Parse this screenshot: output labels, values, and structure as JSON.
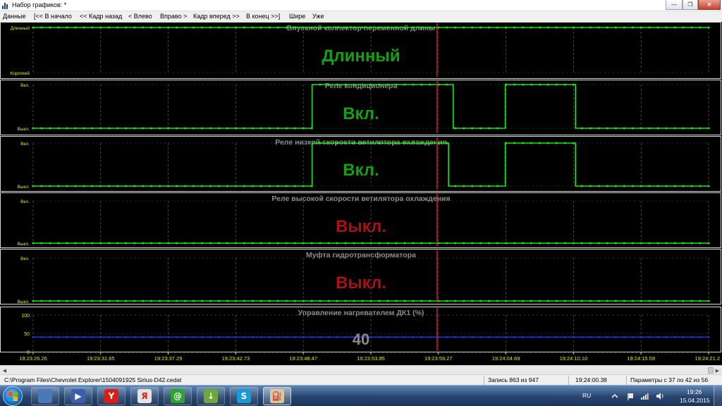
{
  "window": {
    "title": "Набор графиков: *",
    "minimize_label": "—",
    "maximize_label": "❐",
    "close_label": "✕"
  },
  "menu": [
    "Данные",
    "[<< В начало",
    "<< Кадр назад",
    "< Влево",
    "Вправо >",
    "Кадр вперед >>",
    "В конец >>]",
    "Шире",
    "Уже"
  ],
  "chart_data": [
    {
      "type": "line",
      "title": "Впускной коллектор переменной длины",
      "levels": [
        "Короткий",
        "Длинный"
      ],
      "segments": [
        [
          0,
          100,
          1
        ]
      ],
      "current_value": "Длинный",
      "value_color": "#13a013"
    },
    {
      "type": "line",
      "title": "Реле кондиционера",
      "levels": [
        "Выкл.",
        "Вкл."
      ],
      "segments": [
        [
          0,
          41.3,
          0
        ],
        [
          41.3,
          62.2,
          1
        ],
        [
          62.2,
          69.9,
          0
        ],
        [
          69.9,
          80.3,
          1
        ],
        [
          80.3,
          100,
          0
        ]
      ],
      "current_value": "Вкл.",
      "value_color": "#13a013"
    },
    {
      "type": "line",
      "title": "Реле низкой скорости ветилятора охлаждения",
      "levels": [
        "Выкл.",
        "Вкл."
      ],
      "segments": [
        [
          0,
          41.3,
          0
        ],
        [
          41.3,
          61.5,
          1
        ],
        [
          61.5,
          69.9,
          0
        ],
        [
          69.9,
          80.3,
          1
        ],
        [
          80.3,
          100,
          0
        ]
      ],
      "current_value": "Вкл.",
      "value_color": "#13a013"
    },
    {
      "type": "line",
      "title": "Реле высокой скорости ветилятора охлаждения",
      "levels": [
        "Выкл.",
        "Вкл."
      ],
      "segments": [
        [
          0,
          100,
          0
        ]
      ],
      "current_value": "Выкл.",
      "value_color": "#a81212"
    },
    {
      "type": "line",
      "title": "Муфта гидротрансформатора",
      "levels": [
        "Выкл.",
        "Вкл."
      ],
      "segments": [
        [
          0,
          100,
          0
        ]
      ],
      "current_value": "Выкл.",
      "value_color": "#a81212"
    },
    {
      "type": "line",
      "title": "Управление нагревателем ДК1  (%)",
      "ylim": [
        0,
        100
      ],
      "y_ticks": [
        "0",
        "50",
        "100"
      ],
      "value": 40,
      "current_value": "40",
      "value_color": "#8a8a8a",
      "series_color": "#1f2fd6"
    }
  ],
  "x_axis": {
    "ticks": [
      "19:23:26.26",
      "19:23:31.65",
      "19:23:37.29",
      "19:23:42.73",
      "19:23:48.47",
      "19:23:53.85",
      "19:23:59.27",
      "19:24:04.69",
      "19:24:10.10",
      "19:24:15.59",
      "19:24:21.2"
    ],
    "cursor_position": 59.8,
    "cursor_color": "#d41a1a",
    "line_color": "#19e619",
    "grid_color": "#5a5a5a",
    "tick_color": "#e8e800",
    "title_color": "#8c8c8c"
  },
  "status": {
    "file": "C:\\Program Files\\Chevrolet Explorer\\1504091925 Sirius-D42.cedat",
    "record": "Запись 863 из 947",
    "time": "19:24:00.38",
    "params": "Параметры с 37 по 42 из 56"
  },
  "taskbar": {
    "apps": [
      {
        "name": "file-explorer",
        "glyph": "",
        "color": "#4b79b8"
      },
      {
        "name": "media-player",
        "glyph": "▶",
        "color": "#3a5fae"
      },
      {
        "name": "yandex-browser",
        "glyph": "Y",
        "color": "#d91e18"
      },
      {
        "name": "yandex-search",
        "glyph": "Я",
        "color": "#e3e3e3"
      },
      {
        "name": "icq-messenger",
        "glyph": "@",
        "color": "#2fa32f"
      },
      {
        "name": "download-manager",
        "glyph": "↓",
        "color": "#6fa83a"
      },
      {
        "name": "skype",
        "glyph": "S",
        "color": "#1a9bd7"
      },
      {
        "name": "chevrolet-explorer",
        "glyph": "⛽",
        "color": "#d8c89a"
      }
    ],
    "language": "RU",
    "clock_time": "19:26",
    "clock_date": "15.04.2015"
  }
}
